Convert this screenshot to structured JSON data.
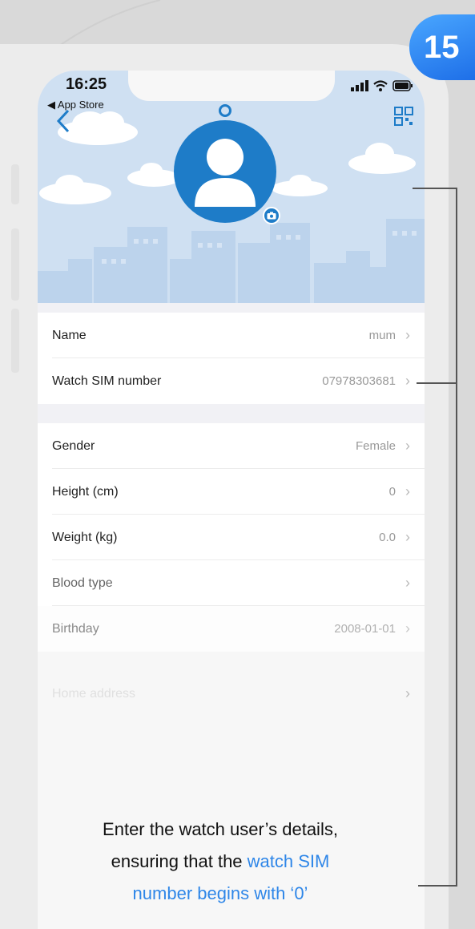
{
  "step_badge": "15",
  "status_bar": {
    "time": "16:25",
    "back_app": "◀ App Store"
  },
  "fields": [
    {
      "label": "Name",
      "value": "mum"
    },
    {
      "label": "Watch SIM number",
      "value": "07978303681"
    },
    {
      "label": "Gender",
      "value": "Female"
    },
    {
      "label": "Height (cm)",
      "value": "0"
    },
    {
      "label": "Weight (kg)",
      "value": "0.0"
    },
    {
      "label": "Blood type",
      "value": ""
    },
    {
      "label": "Birthday",
      "value": "2008-01-01"
    },
    {
      "label": "Home address",
      "value": ""
    }
  ],
  "caption": {
    "line1": "Enter the watch user’s details,",
    "line2_a": "ensuring that the ",
    "line2_b": "watch SIM",
    "line3": "number begins with ‘0’"
  },
  "colors": {
    "accent": "#2e86e8",
    "avatar": "#1e7cc8",
    "header_bg": "#cfe0f2"
  },
  "icons": [
    "back-chevron-icon",
    "qr-code-icon",
    "camera-icon",
    "signal-icon",
    "wifi-icon",
    "battery-icon",
    "chevron-right-icon"
  ]
}
